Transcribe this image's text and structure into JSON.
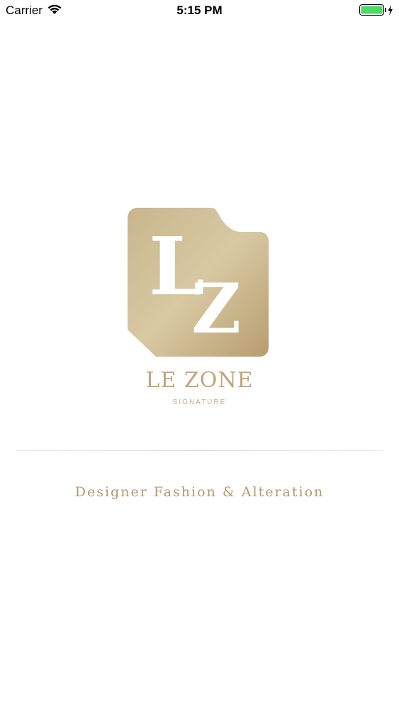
{
  "status_bar": {
    "carrier": "Carrier",
    "time": "5:15 PM",
    "icons": [
      "wifi-icon",
      "battery-icon",
      "charging-bolt-icon"
    ],
    "battery_color": "#4cd964"
  },
  "splash": {
    "logo_monogram": "LZ",
    "brand_name": "LE ZONE",
    "brand_subtitle": "SIGNATURE",
    "tagline": "Designer Fashion & Alteration",
    "gold_color": "#bfa57a"
  }
}
